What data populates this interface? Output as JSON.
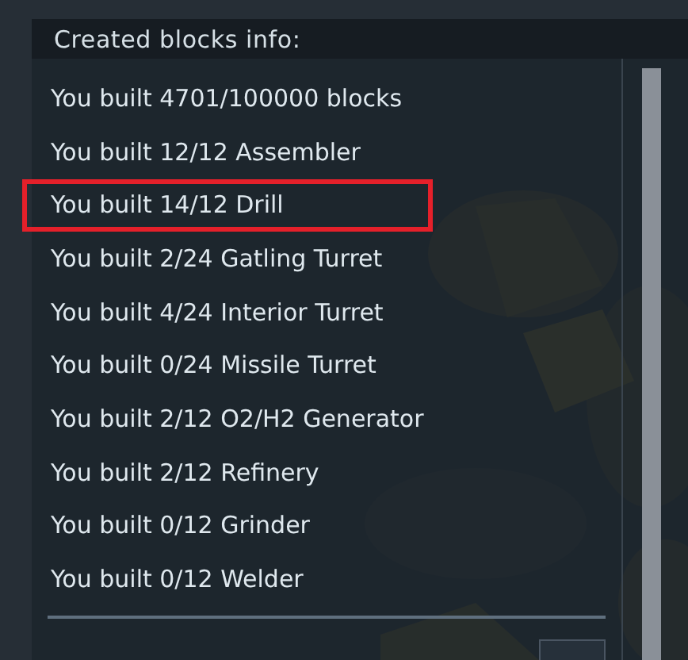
{
  "panel": {
    "title": "Created blocks info:"
  },
  "rows": [
    {
      "text": "You built 4701/100000 blocks",
      "highlighted": false
    },
    {
      "text": "You built 12/12 Assembler",
      "highlighted": false
    },
    {
      "text": "You built 14/12 Drill",
      "highlighted": true
    },
    {
      "text": "You built 2/24 Gatling Turret",
      "highlighted": false
    },
    {
      "text": "You built 4/24 Interior Turret",
      "highlighted": false
    },
    {
      "text": "You built 0/24 Missile Turret",
      "highlighted": false
    },
    {
      "text": "You built 2/12 O2/H2 Generator",
      "highlighted": false
    },
    {
      "text": "You built 2/12 Refinery",
      "highlighted": false
    },
    {
      "text": "You built 0/12 Grinder",
      "highlighted": false
    },
    {
      "text": "You built 0/12 Welder",
      "highlighted": false
    }
  ]
}
